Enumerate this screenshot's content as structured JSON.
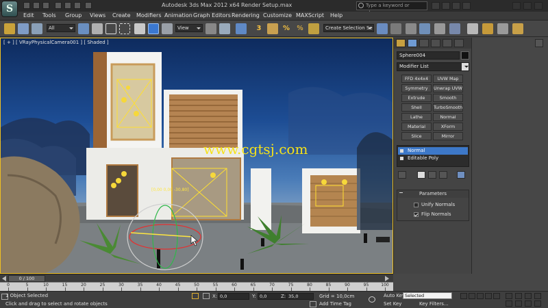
{
  "window": {
    "title": "Autodesk 3ds Max  2012 x64",
    "file": "Render Setup.max",
    "search_placeholder": "Type a keyword or phrase",
    "logo_glyph": "S"
  },
  "menu": {
    "items": [
      "Edit",
      "Tools",
      "Group",
      "Views",
      "Create",
      "Modifiers",
      "Animation",
      "Graph Editors",
      "Rendering",
      "Customize",
      "MAXScript",
      "Help"
    ]
  },
  "toolbar": {
    "filter_value": "All",
    "coord_value": "View",
    "selection_set_placeholder": "Create Selection Se",
    "snap_label": "3",
    "angle_snap_label": "%",
    "spinner_label": "%"
  },
  "viewport": {
    "label": "[ + ] [ VRayPhysicalCamera001 ] [ Shaded ]",
    "watermark": "www.cgtsj.com",
    "transform_readout": "[0,00 0,00 -30,80]",
    "accent": "#f0c020"
  },
  "command_panel": {
    "object_name": "Sphere004",
    "modifier_list_label": "Modifier List",
    "modifier_buttons": [
      "FFD 4x4x4",
      "UVW Map",
      "Symmetry",
      "Unwrap UVW",
      "Extrude",
      "Smooth",
      "Shell",
      "TurboSmooth",
      "Lathe",
      "Normal",
      "Material",
      "XForm",
      "Slice",
      "Mirror"
    ],
    "stack": [
      {
        "label": "Normal",
        "selected": true
      },
      {
        "label": "Editable Poly",
        "selected": false
      }
    ],
    "rollout_title": "Parameters",
    "unify_normals_label": "Unify Normals",
    "unify_normals_checked": false,
    "flip_normals_label": "Flip Normals",
    "flip_normals_checked": true,
    "selection_color": "#3d78c8"
  },
  "timeline": {
    "slider_label": "0 / 100",
    "ticks": [
      "0",
      "5",
      "10",
      "15",
      "20",
      "25",
      "30",
      "35",
      "40",
      "45",
      "50",
      "55",
      "60",
      "65",
      "70",
      "75",
      "80",
      "85",
      "90",
      "95",
      "100"
    ]
  },
  "status": {
    "selection": "1 Object Selected",
    "prompt": "Click and drag to select and rotate objects",
    "x_label": "X:",
    "x_value": "0,0",
    "y_label": "Y:",
    "y_value": "0,0",
    "z_label": "Z:",
    "z_value": "35,0",
    "grid": "Grid = 10,0cm",
    "add_time_tag": "Add Time Tag",
    "auto_key": "Auto Key",
    "set_key": "Set Key",
    "selected_dropdown": "Selected",
    "key_filters": "Key Filters..."
  }
}
